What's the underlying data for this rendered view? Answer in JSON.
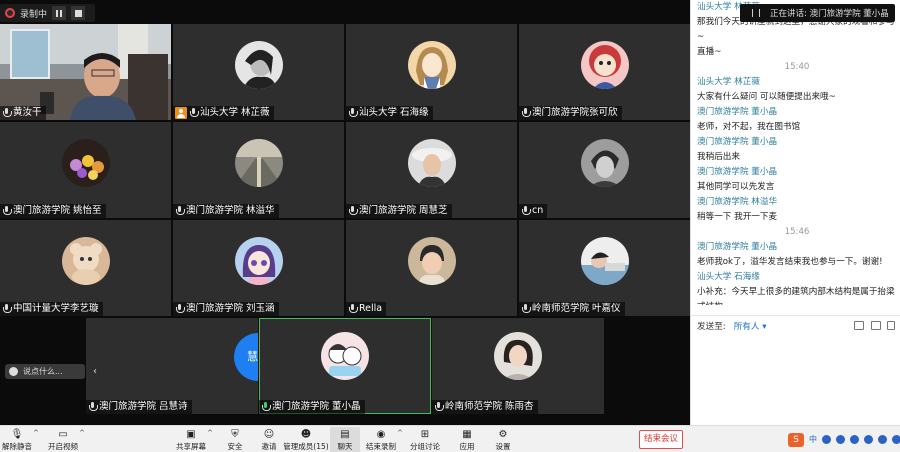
{
  "recording": {
    "label": "录制中"
  },
  "speaking": {
    "text": "正在讲话: 澳门旅游学院 董小晶"
  },
  "participants": [
    {
      "name": "黄汝干",
      "avatar": "video-feed",
      "mic": "muted"
    },
    {
      "name": "汕头大学 林芷薇",
      "avatar": "bw-portrait",
      "mic": "muted",
      "host": true
    },
    {
      "name": "汕头大学 石海缘",
      "avatar": "anime-girl",
      "mic": "muted"
    },
    {
      "name": "澳门旅游学院张可欣",
      "avatar": "cartoon-lion",
      "mic": "muted"
    },
    {
      "name": "澳门旅游学院 姚怡至",
      "avatar": "flower-basket",
      "mic": "muted"
    },
    {
      "name": "澳门旅游学院 林溢华",
      "avatar": "street-photo",
      "mic": "muted"
    },
    {
      "name": "澳门旅游学院 周慧芝",
      "avatar": "hat-selfie",
      "mic": "muted"
    },
    {
      "name": "cn",
      "avatar": "grey-portrait",
      "mic": "muted"
    },
    {
      "name": "中国计量大学李艺璇",
      "avatar": "plush-toy",
      "mic": "muted"
    },
    {
      "name": "澳门旅游学院 刘玉涵",
      "avatar": "anime-purple-hair",
      "mic": "muted"
    },
    {
      "name": "Rella",
      "avatar": "child-photo",
      "mic": "muted"
    },
    {
      "name": "岭南师范学院 叶嘉仪",
      "avatar": "lying-photo",
      "mic": "muted"
    }
  ],
  "bottom_participants": [
    {
      "name": "澳门旅游学院 吕慧诗",
      "avatar_text": "慧诗",
      "mic": "muted"
    },
    {
      "name": "澳门旅游学院 董小晶",
      "avatar": "cartoon-couple",
      "mic": "on",
      "active": true
    },
    {
      "name": "岭南师范学院 陈雨杏",
      "avatar": "girl-photo",
      "mic": "muted"
    }
  ],
  "float_chat": {
    "label": "说点什么..."
  },
  "chat": {
    "entries": [
      {
        "sender": "汕头大学 林芷薇",
        "text": "那我们今天的讲座就到这里，感谢大家的观看和参与~"
      },
      {
        "sender": "",
        "text": "直播~"
      },
      {
        "time": "15:40"
      },
      {
        "sender": "汕头大学 林芷薇",
        "text": "大家有什么疑问 可以随便提出来哦~"
      },
      {
        "sender": "澳门旅游学院 董小晶",
        "text": "老师，对不起，我在图书馆"
      },
      {
        "sender": "澳门旅游学院 董小晶",
        "text": "我稍后出来"
      },
      {
        "sender": "澳门旅游学院 董小晶",
        "text": "其他同学可以先发言"
      },
      {
        "sender": "澳门旅游学院 林溢华",
        "text": "稍等一下 我开一下麦"
      },
      {
        "time": "15:46"
      },
      {
        "sender": "澳门旅游学院 董小晶",
        "text": "老师我ok了，溢华发言结束我也参与一下。谢谢!"
      },
      {
        "sender": "汕头大学 石海缘",
        "text": "小补充：今天早上很多的建筑内部木结构是属于抬梁式结构~"
      }
    ],
    "send_to_label": "发送至:",
    "send_to_value": "所有人 ▾"
  },
  "toolbar": {
    "items": [
      {
        "label": "解除静音",
        "icon": "mic-muted-icon",
        "caret": true
      },
      {
        "label": "开启视频",
        "icon": "camera-off-icon",
        "caret": true
      },
      {
        "label": "共享屏幕",
        "icon": "share-screen-icon",
        "caret": true
      },
      {
        "label": "安全",
        "icon": "shield-icon"
      },
      {
        "label": "邀请",
        "icon": "invite-icon"
      },
      {
        "label": "管理成员(15)",
        "icon": "members-icon"
      },
      {
        "label": "聊天",
        "icon": "chat-icon",
        "pressed": true
      },
      {
        "label": "结束录制",
        "icon": "record-icon",
        "caret": true
      },
      {
        "label": "分组讨论",
        "icon": "breakout-icon"
      },
      {
        "label": "应用",
        "icon": "apps-icon"
      },
      {
        "label": "设置",
        "icon": "settings-icon"
      }
    ],
    "end_meeting": "结束会议"
  },
  "tray": {
    "ime_label": "S",
    "ime_mode": "中"
  },
  "colors": {
    "accent_blue": "#1e7ef2",
    "active_border": "#3cc05a",
    "end_red": "#e03a3a",
    "chat_sender": "#2f7f9c"
  }
}
